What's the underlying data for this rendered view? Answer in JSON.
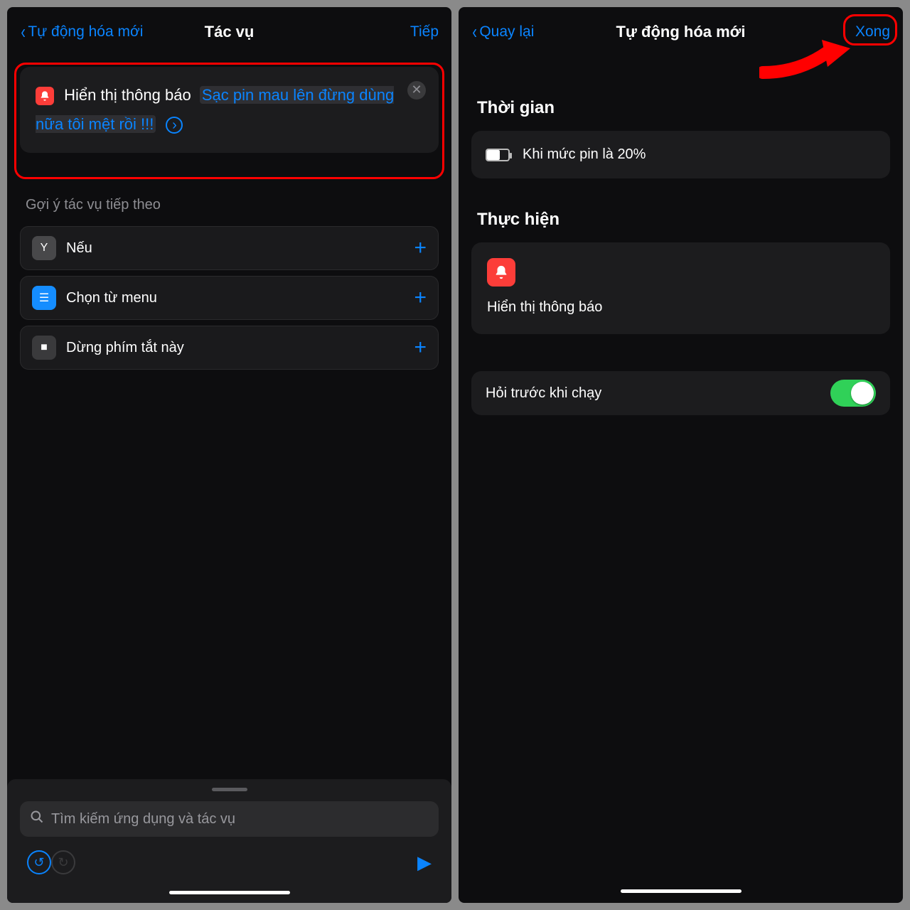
{
  "left": {
    "nav": {
      "back": "Tự động hóa mới",
      "title": "Tác vụ",
      "next": "Tiếp"
    },
    "action": {
      "label": "Hiển thị thông báo",
      "message": "Sạc pin mau lên đừng dùng nữa tôi mệt rồi !!!"
    },
    "suggestions_header": "Gợi ý tác vụ tiếp theo",
    "suggestions": [
      {
        "label": "Nếu"
      },
      {
        "label": "Chọn từ menu"
      },
      {
        "label": "Dừng phím tắt này"
      }
    ],
    "search_placeholder": "Tìm kiếm ứng dụng và tác vụ"
  },
  "right": {
    "nav": {
      "back": "Quay lại",
      "title": "Tự động hóa mới",
      "done": "Xong"
    },
    "section_when": "Thời gian",
    "when_text": "Khi mức pin là 20%",
    "section_do": "Thực hiện",
    "do_action": "Hiển thị thông báo",
    "ask_label": "Hỏi trước khi chạy"
  }
}
